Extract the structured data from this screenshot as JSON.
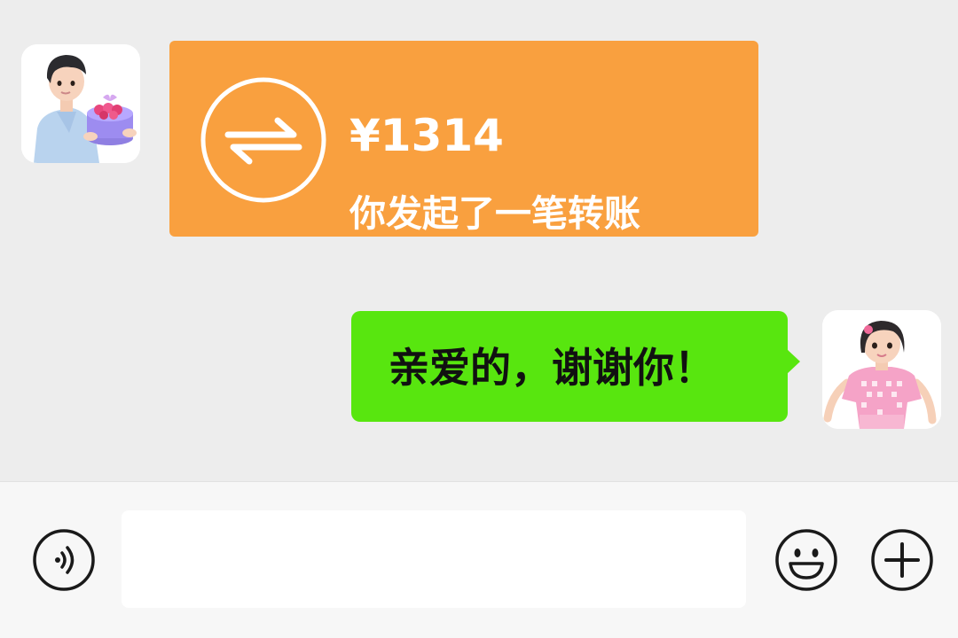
{
  "chat": {
    "transfer": {
      "amount": "¥1314",
      "description": "你发起了一笔转账",
      "icon": "transfer-arrows-icon",
      "color": "#f9a03f"
    },
    "reply": {
      "text": "亲爱的，谢谢你！",
      "color": "#58e60f"
    },
    "contacts": {
      "left_avatar": "boy-with-gift-avatar",
      "right_avatar": "girl-in-pink-avatar"
    }
  },
  "input_bar": {
    "voice_icon": "voice-icon",
    "message_value": "",
    "emoji_icon": "emoji-icon",
    "plus_icon": "plus-icon"
  }
}
